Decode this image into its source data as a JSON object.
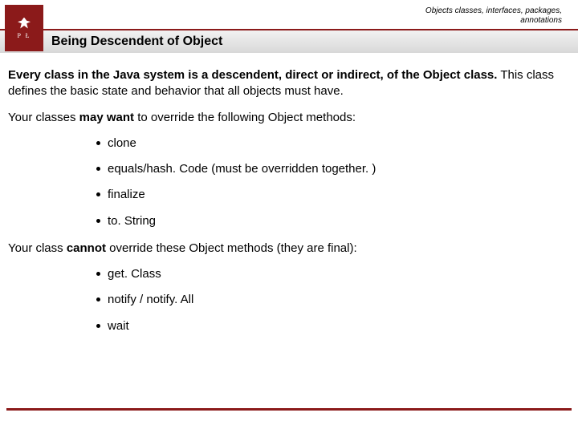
{
  "header": {
    "breadcrumb_line1": "Objects classes, interfaces, packages,",
    "breadcrumb_line2": "annotations",
    "logo_letters": "P   Ł",
    "title": "Being Descendent of Object"
  },
  "body": {
    "p1_bold": "Every class in the Java system is a descendent, direct or indirect, of the Object class.",
    "p1_rest": " This class defines the basic state and behavior that all objects must have.",
    "p2_a": "Your classes ",
    "p2_bold": "may want",
    "p2_b": " to override the following Object methods:",
    "list1": [
      "clone",
      "equals/hash. Code (must be overridden together. )",
      "finalize",
      "to. String"
    ],
    "p3_a": "Your class ",
    "p3_bold": "cannot",
    "p3_b": " override these Object methods (they are final):",
    "list2": [
      "get. Class",
      "notify / notify. All",
      "wait"
    ]
  }
}
